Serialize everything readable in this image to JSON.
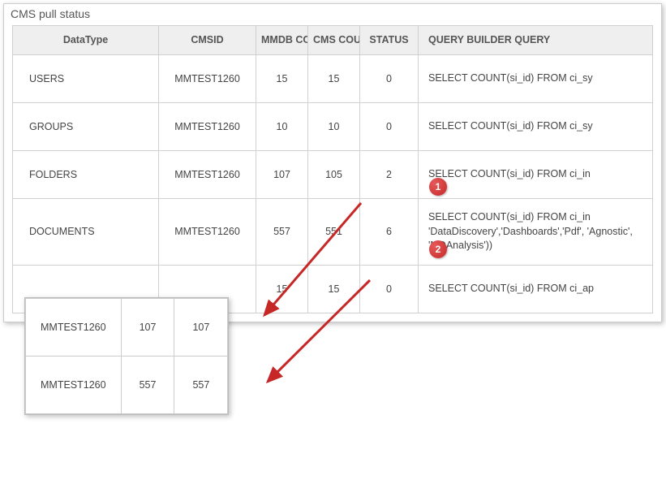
{
  "panel": {
    "title": "CMS pull status"
  },
  "table": {
    "headers": {
      "datatype": "DataType",
      "cmsid": "CMSID",
      "mmdb": "MMDB COUNT",
      "cms": "CMS COUNT",
      "status": "STATUS",
      "query": "QUERY BUILDER QUERY"
    },
    "rows": [
      {
        "datatype": "USERS",
        "cmsid": "MMTEST1260",
        "mmdb": "15",
        "cms": "15",
        "status": "0",
        "status_class": "ok",
        "query": "SELECT COUNT(si_id) FROM ci_sy"
      },
      {
        "datatype": "GROUPS",
        "cmsid": "MMTEST1260",
        "mmdb": "10",
        "cms": "10",
        "status": "0",
        "status_class": "ok",
        "query": "SELECT COUNT(si_id) FROM ci_sy"
      },
      {
        "datatype": "FOLDERS",
        "cmsid": "MMTEST1260",
        "mmdb": "107",
        "cms": "105",
        "status": "2",
        "status_class": "diff",
        "query": "SELECT COUNT(si_id) FROM ci_in"
      },
      {
        "datatype": "DOCUMENTS",
        "cmsid": "MMTEST1260",
        "mmdb": "557",
        "cms": "551",
        "status": "6",
        "status_class": "diff",
        "query": "SELECT COUNT(si_id) FROM ci_in 'DataDiscovery','Dashboards','Pdf', 'Agnostic', 'MDAnalysis'))"
      },
      {
        "datatype": "",
        "cmsid": "",
        "mmdb": "15",
        "cms": "15",
        "status": "0",
        "status_class": "ok",
        "query": "SELECT COUNT(si_id) FROM ci_ap"
      }
    ]
  },
  "overlay": {
    "rows": [
      {
        "cmsid": "MMTEST1260",
        "a": "107",
        "b": "107"
      },
      {
        "cmsid": "MMTEST1260",
        "a": "557",
        "b": "557"
      }
    ]
  },
  "badges": {
    "b1": "1",
    "b2": "2"
  }
}
